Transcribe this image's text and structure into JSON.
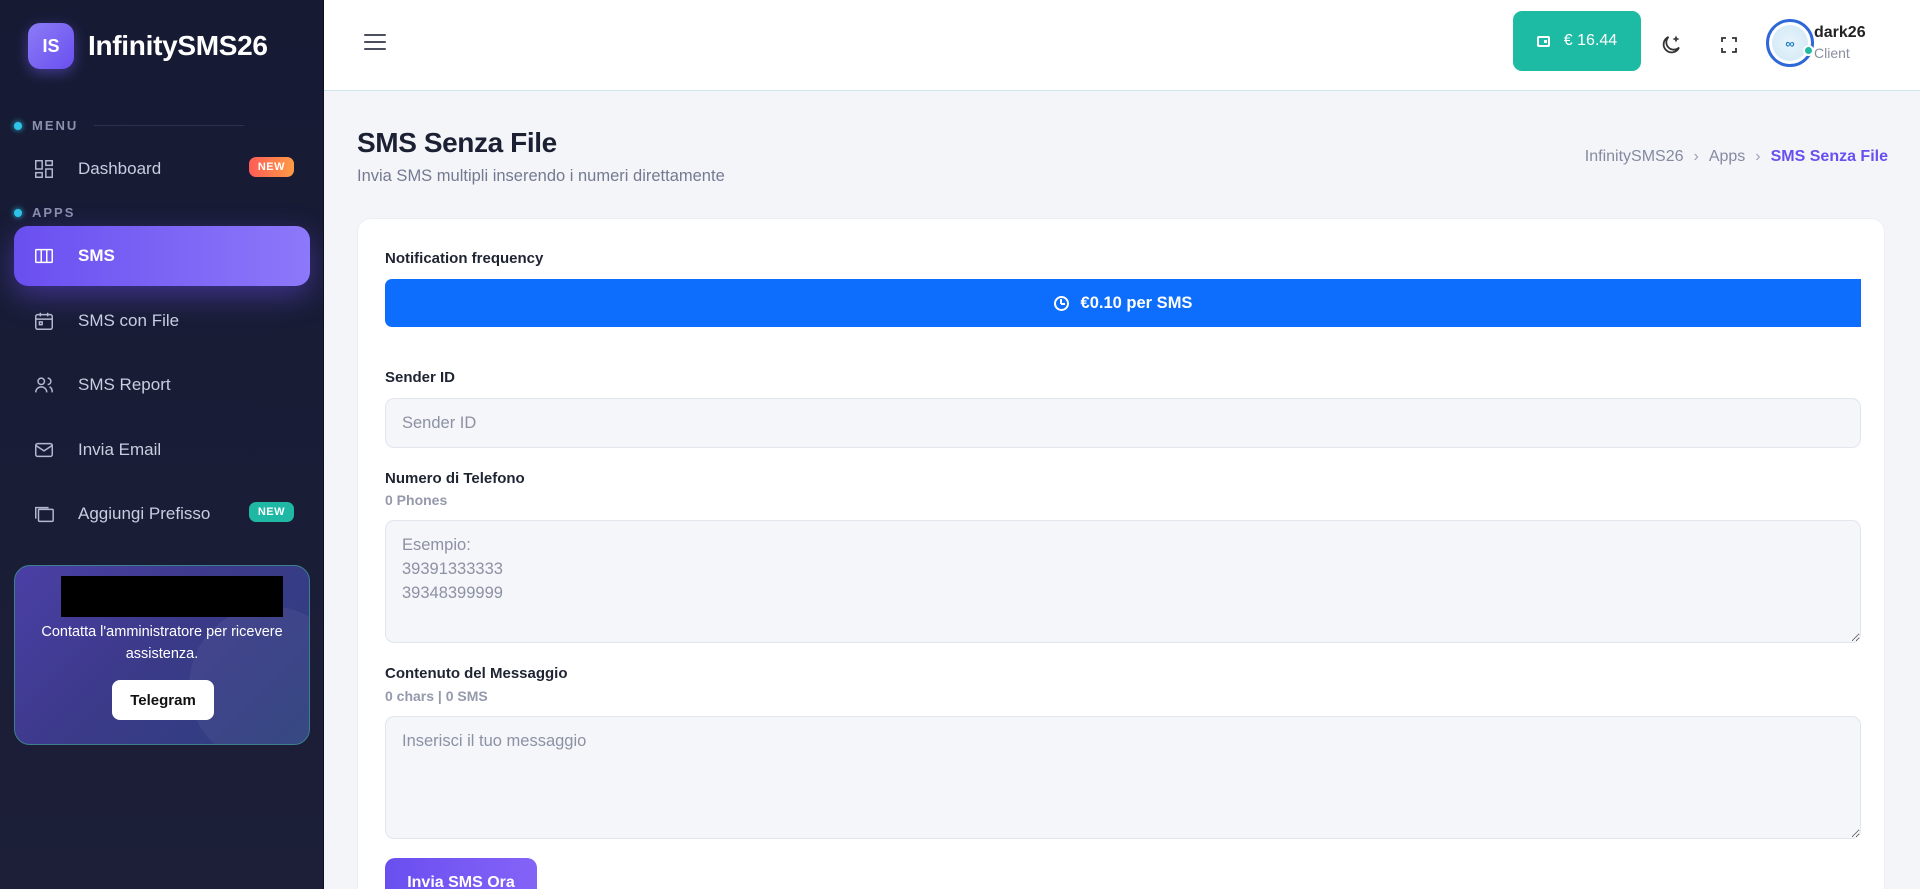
{
  "brand": {
    "logo_text": "IS",
    "name": "InfinitySMS26"
  },
  "sidebar": {
    "menu_label": "MENU",
    "apps_label": "APPS",
    "items": [
      {
        "label": "Dashboard",
        "icon": "dashboard-icon",
        "badge": "NEW"
      },
      {
        "label": "SMS",
        "icon": "sms-icon",
        "active": true
      },
      {
        "label": "SMS con File",
        "icon": "calendar-icon"
      },
      {
        "label": "SMS Report",
        "icon": "users-icon"
      },
      {
        "label": "Invia Email",
        "icon": "mail-icon"
      },
      {
        "label": "Aggiungi Prefisso",
        "icon": "folders-icon",
        "badge": "NEW"
      }
    ],
    "help": {
      "text": "Contatta l'amministratore per ricevere assistenza.",
      "button": "Telegram"
    }
  },
  "topbar": {
    "balance": "€ 16.44",
    "user": {
      "name": "dark26",
      "role": "Client",
      "avatar_text": "∞"
    }
  },
  "page": {
    "title": "SMS Senza File",
    "subtitle": "Invia SMS multipli inserendo i numeri direttamente",
    "breadcrumb": [
      "InfinitySMS26",
      "Apps",
      "SMS Senza File"
    ]
  },
  "form": {
    "frequency_label": "Notification frequency",
    "frequency_value": "€0.10 per SMS",
    "sender_label": "Sender ID",
    "sender_placeholder": "Sender ID",
    "phone_label": "Numero di Telefono",
    "phone_count": "0 Phones",
    "phone_placeholder": "Esempio:\n39391333333\n39348399999",
    "message_label": "Contenuto del Messaggio",
    "message_count": "0 chars | 0 SMS",
    "message_placeholder": "Inserisci il tuo messaggio",
    "submit": "Invia SMS Ora"
  },
  "colors": {
    "accent": "#6a4ff0",
    "teal": "#1dbba4",
    "frequency_bar": "#0d6efd",
    "sidebar_bg": "#161a33"
  }
}
